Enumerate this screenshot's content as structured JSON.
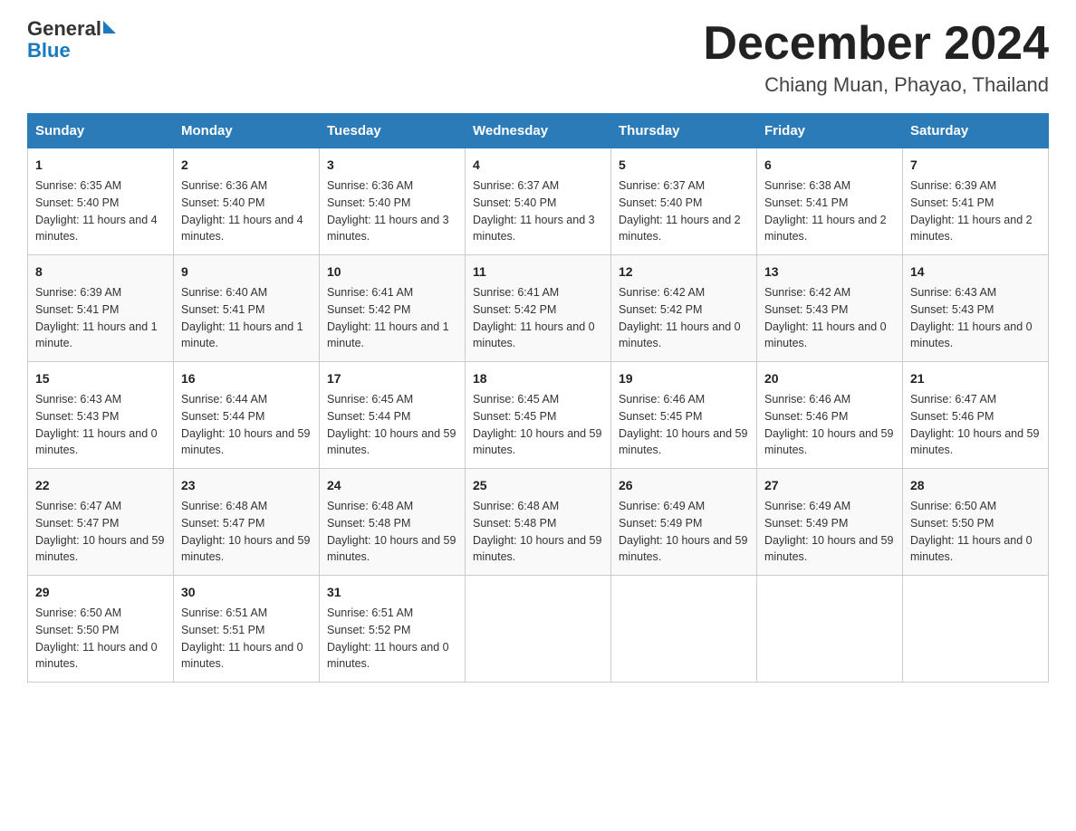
{
  "header": {
    "logo_text_general": "General",
    "logo_text_blue": "Blue",
    "month_title": "December 2024",
    "subtitle": "Chiang Muan, Phayao, Thailand"
  },
  "days_of_week": [
    "Sunday",
    "Monday",
    "Tuesday",
    "Wednesday",
    "Thursday",
    "Friday",
    "Saturday"
  ],
  "weeks": [
    [
      {
        "day": "1",
        "sunrise": "6:35 AM",
        "sunset": "5:40 PM",
        "daylight": "11 hours and 4 minutes."
      },
      {
        "day": "2",
        "sunrise": "6:36 AM",
        "sunset": "5:40 PM",
        "daylight": "11 hours and 4 minutes."
      },
      {
        "day": "3",
        "sunrise": "6:36 AM",
        "sunset": "5:40 PM",
        "daylight": "11 hours and 3 minutes."
      },
      {
        "day": "4",
        "sunrise": "6:37 AM",
        "sunset": "5:40 PM",
        "daylight": "11 hours and 3 minutes."
      },
      {
        "day": "5",
        "sunrise": "6:37 AM",
        "sunset": "5:40 PM",
        "daylight": "11 hours and 2 minutes."
      },
      {
        "day": "6",
        "sunrise": "6:38 AM",
        "sunset": "5:41 PM",
        "daylight": "11 hours and 2 minutes."
      },
      {
        "day": "7",
        "sunrise": "6:39 AM",
        "sunset": "5:41 PM",
        "daylight": "11 hours and 2 minutes."
      }
    ],
    [
      {
        "day": "8",
        "sunrise": "6:39 AM",
        "sunset": "5:41 PM",
        "daylight": "11 hours and 1 minute."
      },
      {
        "day": "9",
        "sunrise": "6:40 AM",
        "sunset": "5:41 PM",
        "daylight": "11 hours and 1 minute."
      },
      {
        "day": "10",
        "sunrise": "6:41 AM",
        "sunset": "5:42 PM",
        "daylight": "11 hours and 1 minute."
      },
      {
        "day": "11",
        "sunrise": "6:41 AM",
        "sunset": "5:42 PM",
        "daylight": "11 hours and 0 minutes."
      },
      {
        "day": "12",
        "sunrise": "6:42 AM",
        "sunset": "5:42 PM",
        "daylight": "11 hours and 0 minutes."
      },
      {
        "day": "13",
        "sunrise": "6:42 AM",
        "sunset": "5:43 PM",
        "daylight": "11 hours and 0 minutes."
      },
      {
        "day": "14",
        "sunrise": "6:43 AM",
        "sunset": "5:43 PM",
        "daylight": "11 hours and 0 minutes."
      }
    ],
    [
      {
        "day": "15",
        "sunrise": "6:43 AM",
        "sunset": "5:43 PM",
        "daylight": "11 hours and 0 minutes."
      },
      {
        "day": "16",
        "sunrise": "6:44 AM",
        "sunset": "5:44 PM",
        "daylight": "10 hours and 59 minutes."
      },
      {
        "day": "17",
        "sunrise": "6:45 AM",
        "sunset": "5:44 PM",
        "daylight": "10 hours and 59 minutes."
      },
      {
        "day": "18",
        "sunrise": "6:45 AM",
        "sunset": "5:45 PM",
        "daylight": "10 hours and 59 minutes."
      },
      {
        "day": "19",
        "sunrise": "6:46 AM",
        "sunset": "5:45 PM",
        "daylight": "10 hours and 59 minutes."
      },
      {
        "day": "20",
        "sunrise": "6:46 AM",
        "sunset": "5:46 PM",
        "daylight": "10 hours and 59 minutes."
      },
      {
        "day": "21",
        "sunrise": "6:47 AM",
        "sunset": "5:46 PM",
        "daylight": "10 hours and 59 minutes."
      }
    ],
    [
      {
        "day": "22",
        "sunrise": "6:47 AM",
        "sunset": "5:47 PM",
        "daylight": "10 hours and 59 minutes."
      },
      {
        "day": "23",
        "sunrise": "6:48 AM",
        "sunset": "5:47 PM",
        "daylight": "10 hours and 59 minutes."
      },
      {
        "day": "24",
        "sunrise": "6:48 AM",
        "sunset": "5:48 PM",
        "daylight": "10 hours and 59 minutes."
      },
      {
        "day": "25",
        "sunrise": "6:48 AM",
        "sunset": "5:48 PM",
        "daylight": "10 hours and 59 minutes."
      },
      {
        "day": "26",
        "sunrise": "6:49 AM",
        "sunset": "5:49 PM",
        "daylight": "10 hours and 59 minutes."
      },
      {
        "day": "27",
        "sunrise": "6:49 AM",
        "sunset": "5:49 PM",
        "daylight": "10 hours and 59 minutes."
      },
      {
        "day": "28",
        "sunrise": "6:50 AM",
        "sunset": "5:50 PM",
        "daylight": "11 hours and 0 minutes."
      }
    ],
    [
      {
        "day": "29",
        "sunrise": "6:50 AM",
        "sunset": "5:50 PM",
        "daylight": "11 hours and 0 minutes."
      },
      {
        "day": "30",
        "sunrise": "6:51 AM",
        "sunset": "5:51 PM",
        "daylight": "11 hours and 0 minutes."
      },
      {
        "day": "31",
        "sunrise": "6:51 AM",
        "sunset": "5:52 PM",
        "daylight": "11 hours and 0 minutes."
      },
      null,
      null,
      null,
      null
    ]
  ],
  "labels": {
    "sunrise": "Sunrise:",
    "sunset": "Sunset:",
    "daylight": "Daylight:"
  }
}
